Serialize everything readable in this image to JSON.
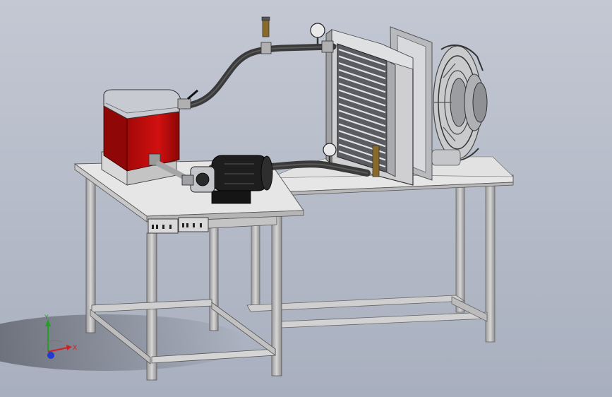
{
  "viewport": {
    "background_top": "#c3c8d3",
    "background_bottom": "#a8afbe"
  },
  "model": {
    "table_color": "#e6e6e6",
    "frame_color": "#bdbdbd",
    "tank_body_color": "#c80c0c",
    "tank_lid_color": "#c8cad2",
    "hose_color": "#3a3a3a",
    "pump_color": "#1e1e1e",
    "radiator_color": "#cfcfd2",
    "fan_frame_color": "#b7b9bd",
    "outlet_color": "#d9d9d9"
  },
  "triad": {
    "x_label": "X",
    "y_label": "Y",
    "x_color": "#d12020",
    "y_color": "#1fa31f",
    "z_color": "#1f3bd1"
  }
}
